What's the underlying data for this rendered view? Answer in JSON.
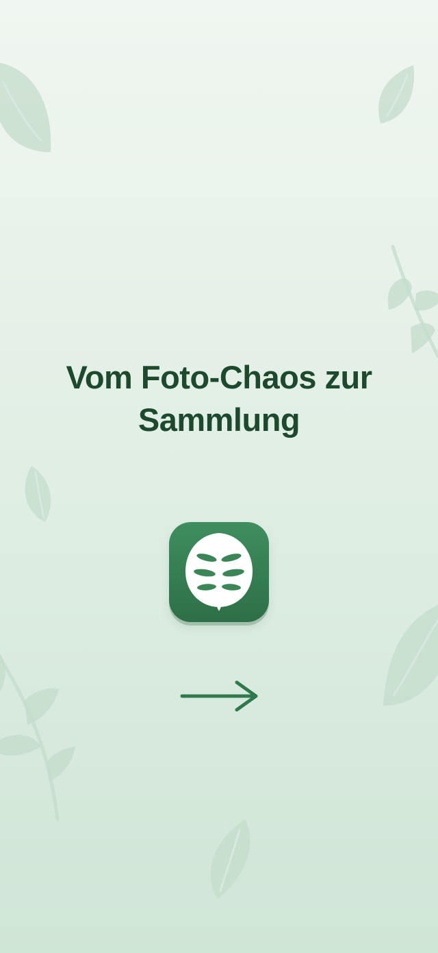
{
  "onboarding": {
    "title_line_1": "Vom Foto-Chaos zur",
    "title_line_2": "Sammlung",
    "app_icon": "leaf-icon",
    "next_icon": "arrow-right-icon"
  },
  "theme": {
    "background_top": "#f0f6f1",
    "background_bottom": "#cfe5d6",
    "text_color": "#1d4a2f",
    "accent": "#2f7a4c",
    "decoration_color": "#b7d4c0"
  }
}
